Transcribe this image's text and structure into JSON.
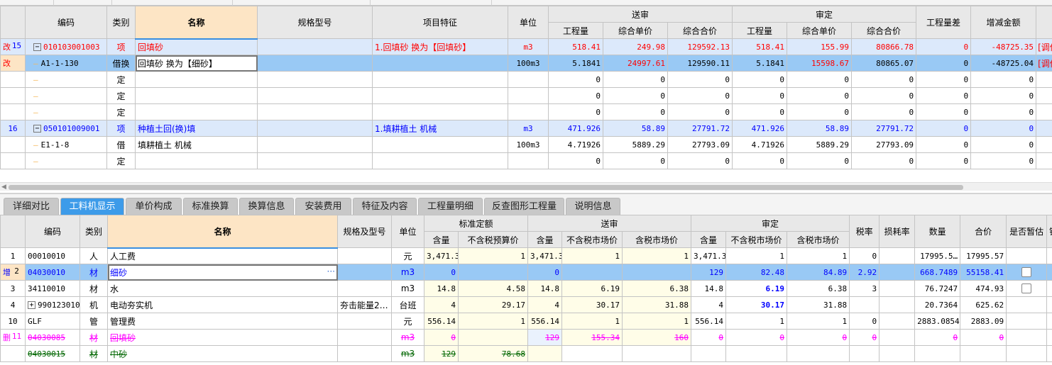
{
  "upper": {
    "headers": {
      "code": "编码",
      "type": "类别",
      "name": "名称",
      "spec": "规格型号",
      "feature": "项目特征",
      "unit": "单位",
      "submitted": "送审",
      "approved": "审定",
      "qty": "工程量",
      "unit_price": "综合单价",
      "total_price": "综合合价",
      "qty_diff": "工程量差",
      "delta": "增减金额"
    },
    "rows": [
      {
        "mark": "改",
        "num": "15",
        "code": "010103001003",
        "expand": "−",
        "type": "项",
        "name": "回填砂",
        "spec": "",
        "feature": "1.回填砂  换为【回填砂】",
        "unit": "m3",
        "s_qty": "518.41",
        "s_up": "249.98",
        "s_tp": "129592.13",
        "a_qty": "518.41",
        "a_up": "155.99",
        "a_tp": "80866.78",
        "diff": "0",
        "delta": "-48725.35",
        "extra": "[调价",
        "style": "item-modified"
      },
      {
        "mark": "改",
        "num": "",
        "code": "A1-1-130",
        "type": "借换",
        "name": "回填砂    换为【细砂】",
        "spec": "",
        "feature": "",
        "unit": "100m3",
        "s_qty": "5.1841",
        "s_up": "24997.61",
        "s_tp": "129590.11",
        "a_qty": "5.1841",
        "a_up": "15598.67",
        "a_tp": "80865.07",
        "diff": "0",
        "delta": "-48725.04",
        "extra": "[调价",
        "style": "selected"
      },
      {
        "mark": "",
        "num": "",
        "code": "",
        "type": "定",
        "name": "",
        "spec": "",
        "feature": "",
        "unit": "",
        "s_qty": "0",
        "s_up": "0",
        "s_tp": "0",
        "a_qty": "0",
        "a_up": "0",
        "a_tp": "0",
        "diff": "0",
        "delta": "0",
        "extra": "",
        "style": "sub"
      },
      {
        "mark": "",
        "num": "",
        "code": "",
        "type": "定",
        "name": "",
        "spec": "",
        "feature": "",
        "unit": "",
        "s_qty": "0",
        "s_up": "0",
        "s_tp": "0",
        "a_qty": "0",
        "a_up": "0",
        "a_tp": "0",
        "diff": "0",
        "delta": "0",
        "extra": "",
        "style": "sub"
      },
      {
        "mark": "",
        "num": "",
        "code": "",
        "type": "定",
        "name": "",
        "spec": "",
        "feature": "",
        "unit": "",
        "s_qty": "0",
        "s_up": "0",
        "s_tp": "0",
        "a_qty": "0",
        "a_up": "0",
        "a_tp": "0",
        "diff": "0",
        "delta": "0",
        "extra": "",
        "style": "sub"
      },
      {
        "mark": "",
        "num": "16",
        "code": "050101009001",
        "expand": "−",
        "type": "项",
        "name": "种植土回(换)填",
        "spec": "",
        "feature": "1.填耕植土 机械",
        "unit": "m3",
        "s_qty": "471.926",
        "s_up": "58.89",
        "s_tp": "27791.72",
        "a_qty": "471.926",
        "a_up": "58.89",
        "a_tp": "27791.72",
        "diff": "0",
        "delta": "0",
        "extra": "",
        "style": "item"
      },
      {
        "mark": "",
        "num": "",
        "code": "E1-1-8",
        "type": "借",
        "name": "填耕植土 机械",
        "spec": "",
        "feature": "",
        "unit": "100m3",
        "s_qty": "4.71926",
        "s_up": "5889.29",
        "s_tp": "27793.09",
        "a_qty": "4.71926",
        "a_up": "5889.29",
        "a_tp": "27793.09",
        "diff": "0",
        "delta": "0",
        "extra": "",
        "style": "sub"
      },
      {
        "mark": "",
        "num": "",
        "code": "",
        "type": "定",
        "name": "",
        "spec": "",
        "feature": "",
        "unit": "",
        "s_qty": "0",
        "s_up": "0",
        "s_tp": "0",
        "a_qty": "0",
        "a_up": "0",
        "a_tp": "0",
        "diff": "0",
        "delta": "0",
        "extra": "",
        "style": "sub"
      }
    ]
  },
  "tabs": [
    {
      "label": "详细对比",
      "active": false
    },
    {
      "label": "工料机显示",
      "active": true
    },
    {
      "label": "单价构成",
      "active": false
    },
    {
      "label": "标准换算",
      "active": false
    },
    {
      "label": "换算信息",
      "active": false
    },
    {
      "label": "安装费用",
      "active": false
    },
    {
      "label": "特征及内容",
      "active": false
    },
    {
      "label": "工程量明细",
      "active": false
    },
    {
      "label": "反查图形工程量",
      "active": false
    },
    {
      "label": "说明信息",
      "active": false
    }
  ],
  "lower": {
    "headers": {
      "code": "编码",
      "type": "类别",
      "name": "名称",
      "spec": "规格及型号",
      "unit": "单位",
      "standard": "标准定额",
      "submitted": "送审",
      "approved": "审定",
      "qty": "含量",
      "std_price": "不含税预算价",
      "price_ex": "不含税市场价",
      "price_in": "含税市场价",
      "tax": "税率",
      "loss": "损耗率",
      "amount": "数量",
      "total": "合价",
      "provisional": "是否暂估",
      "extra": "锁"
    },
    "rows": [
      {
        "mark": "",
        "num": "1",
        "code": "00010010",
        "type": "人",
        "name": "人工费",
        "spec": "",
        "unit": "元",
        "std_qty": "3,471.3",
        "std_price": "1",
        "s_qty": "3,471.3",
        "s_ex": "1",
        "s_in": "1",
        "a_qty": "3,471.3",
        "a_ex": "1",
        "a_in": "1",
        "tax": "0",
        "loss": "",
        "amount": "17995.5…",
        "total": "17995.57",
        "prov": false,
        "style": "normal"
      },
      {
        "mark": "增",
        "num": "2",
        "code": "04030010",
        "type": "材",
        "name": "细砂",
        "name_btn": "···",
        "spec": "",
        "unit": "m3",
        "std_qty": "0",
        "std_price": "",
        "s_qty": "0",
        "s_ex": "",
        "s_in": "",
        "a_qty": "129",
        "a_ex": "82.48",
        "a_in": "84.89",
        "tax": "2.92",
        "loss": "",
        "amount": "668.7489",
        "total": "55158.41",
        "prov": true,
        "style": "selected"
      },
      {
        "mark": "",
        "num": "3",
        "code": "34110010",
        "type": "材",
        "name": "水",
        "spec": "",
        "unit": "m3",
        "std_qty": "14.8",
        "std_price": "4.58",
        "s_qty": "14.8",
        "s_ex": "6.19",
        "s_in": "6.38",
        "a_qty": "14.8",
        "a_ex": "6.19",
        "a_in": "6.38",
        "tax": "3",
        "loss": "",
        "amount": "76.7247",
        "total": "474.93",
        "prov": true,
        "style": "normal",
        "bold_ex": true
      },
      {
        "mark": "",
        "num": "4",
        "code": "990123010",
        "expand": "+",
        "type": "机",
        "name": "电动夯实机",
        "spec": "夯击能量2…",
        "unit": "台班",
        "std_qty": "4",
        "std_price": "29.17",
        "s_qty": "4",
        "s_ex": "30.17",
        "s_in": "31.88",
        "a_qty": "4",
        "a_ex": "30.17",
        "a_in": "31.88",
        "tax": "",
        "loss": "",
        "amount": "20.7364",
        "total": "625.62",
        "prov": false,
        "style": "normal",
        "bold_ex": true
      },
      {
        "mark": "",
        "num": "10",
        "code": "GLF",
        "type": "管",
        "name": "管理费",
        "spec": "",
        "unit": "元",
        "std_qty": "556.14",
        "std_price": "1",
        "s_qty": "556.14",
        "s_ex": "1",
        "s_in": "1",
        "a_qty": "556.14",
        "a_ex": "1",
        "a_in": "1",
        "tax": "0",
        "loss": "",
        "amount": "2883.0854",
        "total": "2883.09",
        "prov": false,
        "style": "normal"
      },
      {
        "mark": "删",
        "num": "11",
        "code": "04030085",
        "type": "材",
        "name": "回填砂",
        "spec": "",
        "unit": "m3",
        "std_qty": "0",
        "std_price": "",
        "s_qty": "129",
        "s_ex": "155.34",
        "s_in": "160",
        "a_qty": "0",
        "a_ex": "0",
        "a_in": "0",
        "tax": "0",
        "loss": "",
        "amount": "0",
        "total": "0",
        "prov": false,
        "style": "deleted"
      },
      {
        "mark": "",
        "num": "",
        "code": "04030015",
        "type": "材",
        "name": "中砂",
        "spec": "",
        "unit": "m3",
        "std_qty": "129",
        "std_price": "78.68",
        "s_qty": "",
        "s_ex": "",
        "s_in": "",
        "a_qty": "",
        "a_ex": "",
        "a_in": "",
        "tax": "",
        "loss": "",
        "amount": "",
        "total": "",
        "prov": false,
        "style": "replaced"
      }
    ]
  }
}
